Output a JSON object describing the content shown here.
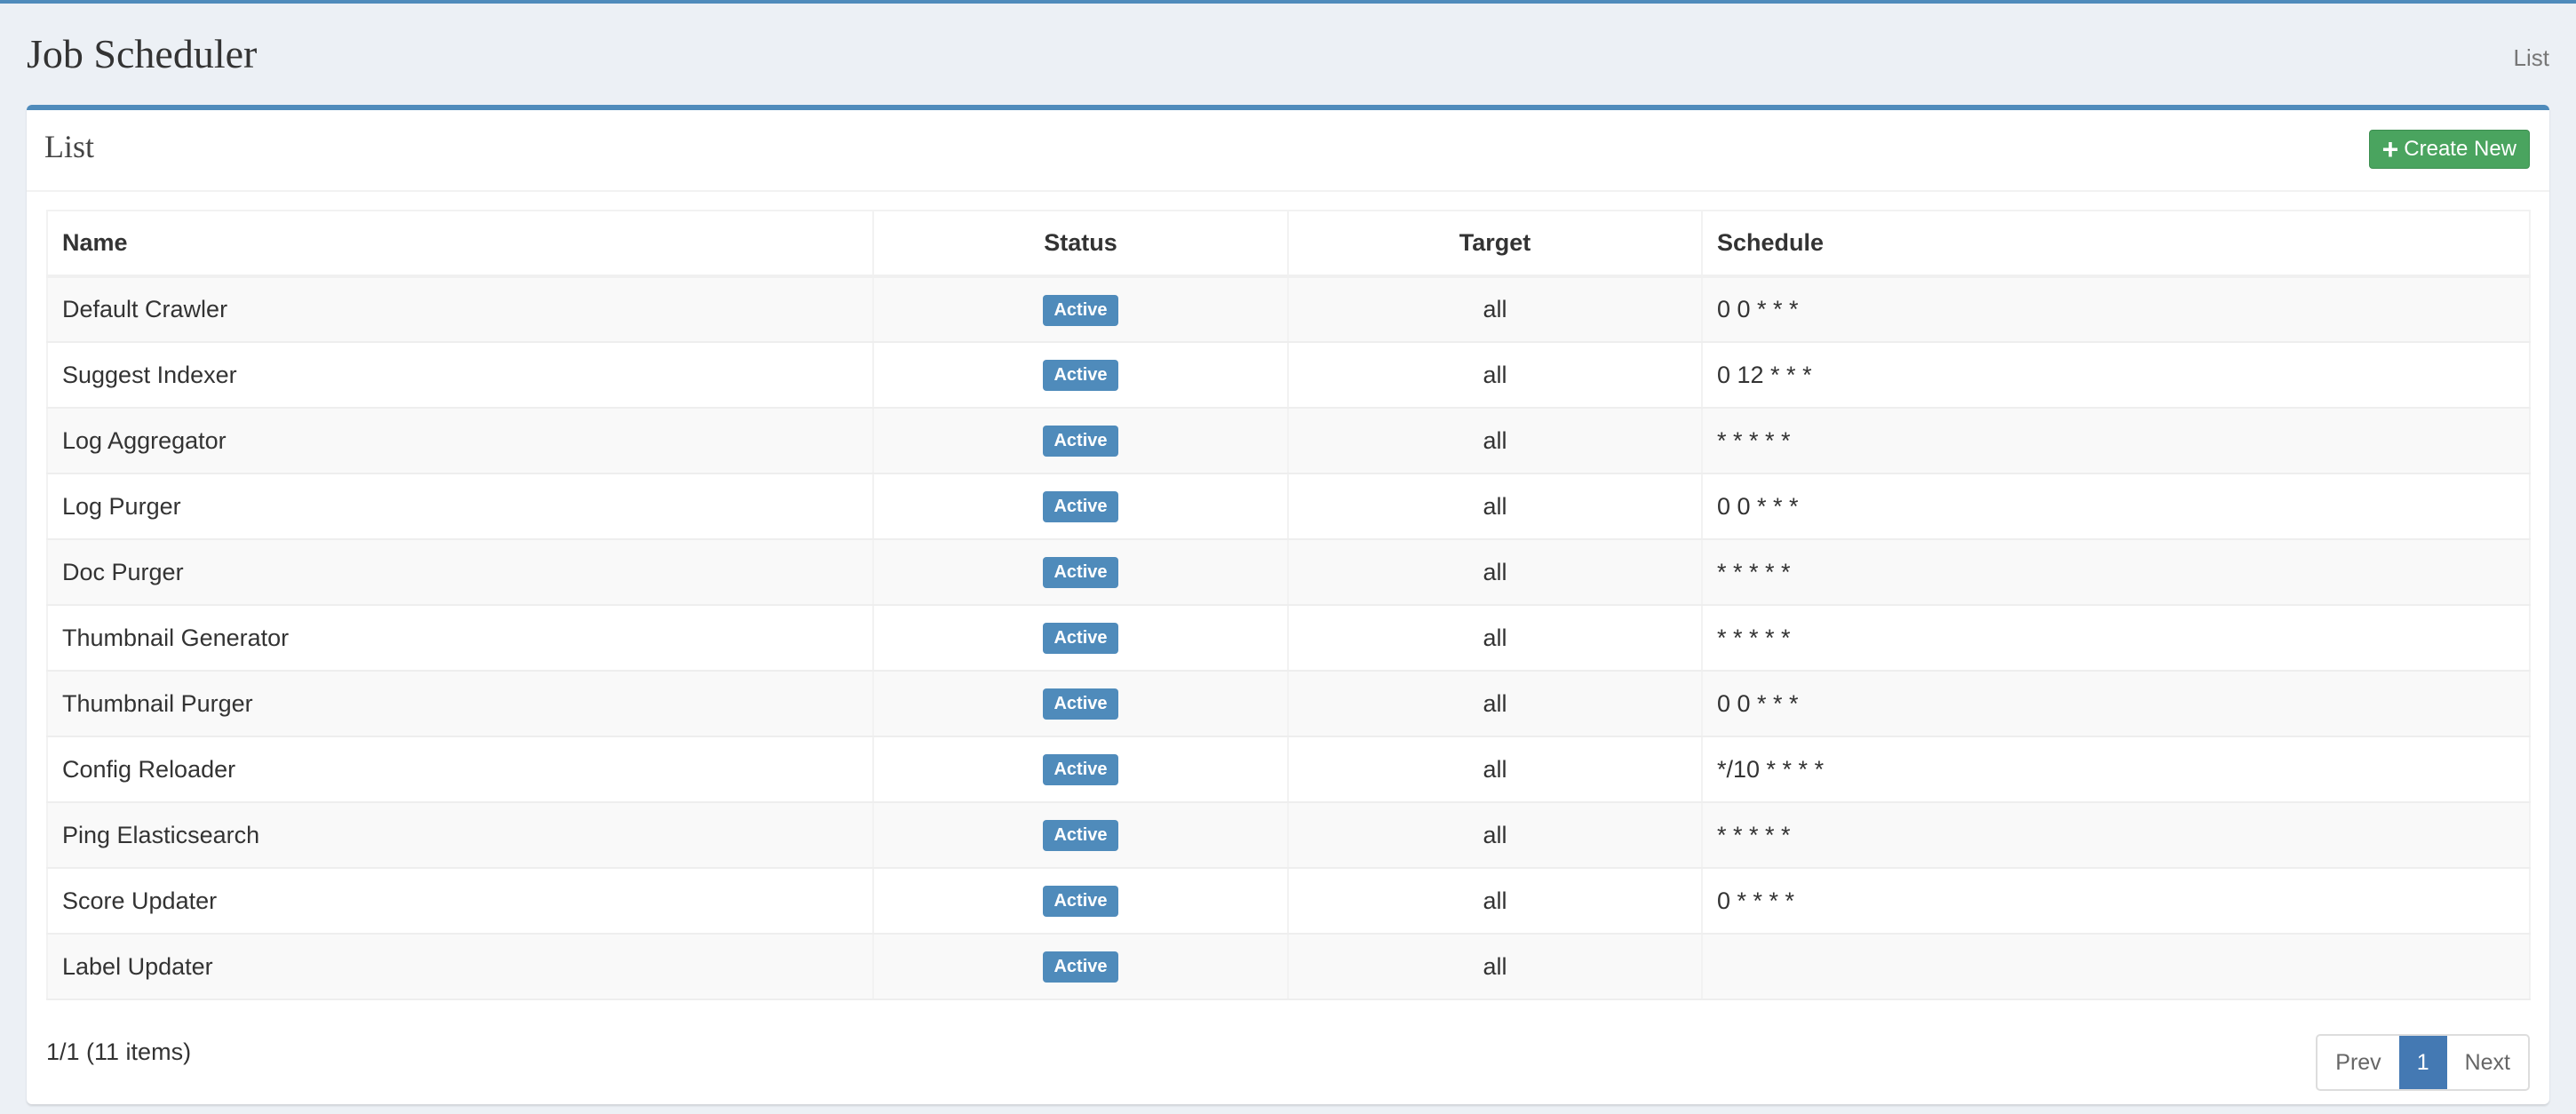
{
  "header": {
    "title": "Job Scheduler",
    "breadcrumb": "List"
  },
  "card": {
    "title": "List",
    "create_label": "Create New"
  },
  "table": {
    "columns": [
      "Name",
      "Status",
      "Target",
      "Schedule"
    ],
    "rows": [
      {
        "name": "Default Crawler",
        "status": "Active",
        "target": "all",
        "schedule": "0 0 * * *"
      },
      {
        "name": "Suggest Indexer",
        "status": "Active",
        "target": "all",
        "schedule": "0 12 * * *"
      },
      {
        "name": "Log Aggregator",
        "status": "Active",
        "target": "all",
        "schedule": "* * * * *"
      },
      {
        "name": "Log Purger",
        "status": "Active",
        "target": "all",
        "schedule": "0 0 * * *"
      },
      {
        "name": "Doc Purger",
        "status": "Active",
        "target": "all",
        "schedule": "* * * * *"
      },
      {
        "name": "Thumbnail Generator",
        "status": "Active",
        "target": "all",
        "schedule": "* * * * *"
      },
      {
        "name": "Thumbnail Purger",
        "status": "Active",
        "target": "all",
        "schedule": "0 0 * * *"
      },
      {
        "name": "Config Reloader",
        "status": "Active",
        "target": "all",
        "schedule": "*/10 * * * *"
      },
      {
        "name": "Ping Elasticsearch",
        "status": "Active",
        "target": "all",
        "schedule": "* * * * *"
      },
      {
        "name": "Score Updater",
        "status": "Active",
        "target": "all",
        "schedule": "0 * * * *"
      },
      {
        "name": "Label Updater",
        "status": "Active",
        "target": "all",
        "schedule": ""
      }
    ]
  },
  "footer": {
    "summary": "1/1 (11 items)",
    "prev": "Prev",
    "page": "1",
    "next": "Next"
  }
}
